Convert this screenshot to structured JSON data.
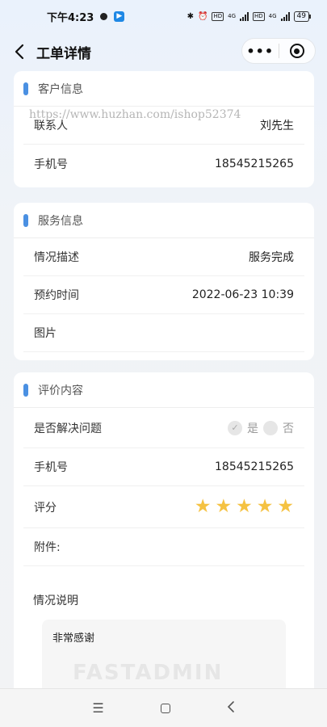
{
  "status": {
    "time": "下午4:23",
    "network_label_1": "4G",
    "hd_1": "HD",
    "network_label_2": "4G",
    "hd_2": "HD",
    "battery": "49"
  },
  "nav": {
    "title": "工单详情",
    "more_label": "•••"
  },
  "watermark": {
    "url": "https://www.huzhan.com/ishop52374",
    "logo": "FASTADMIN"
  },
  "customer": {
    "title": "客户信息",
    "rows": [
      {
        "label": "联系人",
        "value": "刘先生"
      },
      {
        "label": "手机号",
        "value": "18545215265"
      }
    ]
  },
  "service": {
    "title": "服务信息",
    "rows": [
      {
        "label": "情况描述",
        "value": "服务完成"
      },
      {
        "label": "预约时间",
        "value": "2022-06-23 10:39"
      },
      {
        "label": "图片",
        "value": ""
      }
    ]
  },
  "review": {
    "title": "评价内容",
    "resolved_label": "是否解决问题",
    "yes_label": "是",
    "no_label": "否",
    "phone_label": "手机号",
    "phone_value": "18545215265",
    "rating_label": "评分",
    "rating": 5,
    "rating_max": 5,
    "attachment_label": "附件:",
    "note_label": "情况说明",
    "note_text": "非常感谢"
  },
  "colors": {
    "accent": "#4a90e2",
    "star": "#f5c242"
  }
}
